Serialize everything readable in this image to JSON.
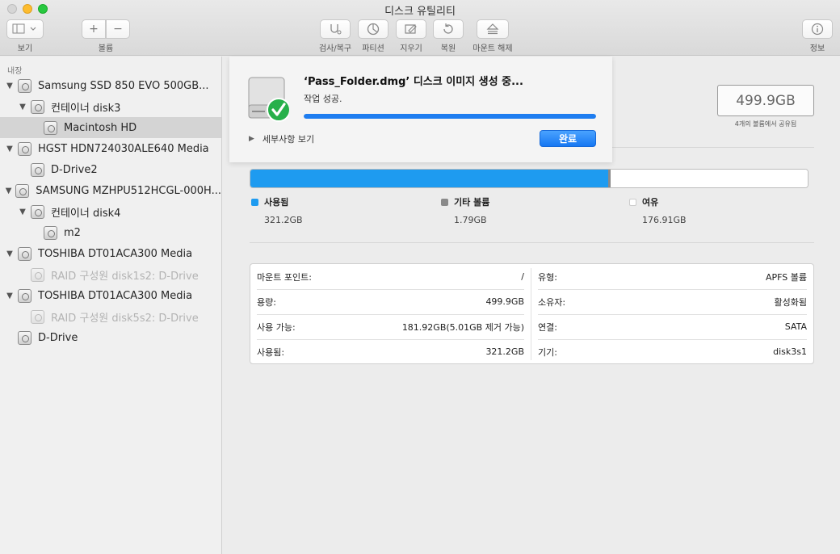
{
  "window": {
    "title": "디스크 유틸리티"
  },
  "toolbar": {
    "view_label": "보기",
    "volume_label": "볼륨",
    "firstaid_label": "검사/복구",
    "partition_label": "파티션",
    "erase_label": "지우기",
    "restore_label": "복원",
    "unmount_label": "마운트 해제",
    "info_label": "정보",
    "add_symbol": "+",
    "remove_symbol": "−"
  },
  "sidebar": {
    "header": "내장",
    "items": [
      {
        "label": "Samsung SSD 850 EVO 500GB...",
        "level": 0,
        "expanded": true,
        "selected": false,
        "dim": false
      },
      {
        "label": "컨테이너 disk3",
        "level": 1,
        "expanded": true,
        "selected": false,
        "dim": false
      },
      {
        "label": "Macintosh HD",
        "level": 2,
        "expanded": null,
        "selected": true,
        "dim": false
      },
      {
        "label": "HGST HDN724030ALE640 Media",
        "level": 0,
        "expanded": true,
        "selected": false,
        "dim": false
      },
      {
        "label": "D-Drive2",
        "level": 1,
        "expanded": null,
        "selected": false,
        "dim": false
      },
      {
        "label": "SAMSUNG MZHPU512HCGL-000H...",
        "level": 0,
        "expanded": true,
        "selected": false,
        "dim": false
      },
      {
        "label": "컨테이너 disk4",
        "level": 1,
        "expanded": true,
        "selected": false,
        "dim": false
      },
      {
        "label": "m2",
        "level": 2,
        "expanded": null,
        "selected": false,
        "dim": false
      },
      {
        "label": "TOSHIBA DT01ACA300 Media",
        "level": 0,
        "expanded": true,
        "selected": false,
        "dim": false
      },
      {
        "label": "RAID 구성원 disk1s2: D-Drive",
        "level": 1,
        "expanded": null,
        "selected": false,
        "dim": true
      },
      {
        "label": "TOSHIBA DT01ACA300 Media",
        "level": 0,
        "expanded": true,
        "selected": false,
        "dim": false
      },
      {
        "label": "RAID 구성원 disk5s2: D-Drive",
        "level": 1,
        "expanded": null,
        "selected": false,
        "dim": true
      },
      {
        "label": "D-Drive",
        "level": 0,
        "expanded": null,
        "selected": false,
        "dim": false
      }
    ]
  },
  "sheet": {
    "title": "‘Pass_Folder.dmg’ 디스크 이미지 생성 중...",
    "status": "작업 성공.",
    "progress": 1.0,
    "details_label": "세부사항 보기",
    "done_label": "완료"
  },
  "capacity": {
    "total": "499.9GB",
    "note": "4개의 볼륨에서 공유됨"
  },
  "usage": {
    "segments": [
      {
        "name": "사용됨",
        "value": "321.2GB",
        "gb": 321.2,
        "color": "#1e9bf0"
      },
      {
        "name": "기타 볼륨",
        "value": "1.79GB",
        "gb": 1.79,
        "color": "#8a8a8a"
      },
      {
        "name": "여유",
        "value": "176.91GB",
        "gb": 176.91,
        "color": "#ffffff"
      }
    ]
  },
  "info": {
    "left": [
      {
        "label": "마운트 포인트:",
        "value": "/"
      },
      {
        "label": "용량:",
        "value": "499.9GB"
      },
      {
        "label": "사용 가능:",
        "value": "181.92GB(5.01GB 제거 가능)"
      },
      {
        "label": "사용됨:",
        "value": "321.2GB"
      }
    ],
    "right": [
      {
        "label": "유형:",
        "value": "APFS 볼륨"
      },
      {
        "label": "소유자:",
        "value": "활성화됨"
      },
      {
        "label": "연결:",
        "value": "SATA"
      },
      {
        "label": "기기:",
        "value": "disk3s1"
      }
    ]
  }
}
